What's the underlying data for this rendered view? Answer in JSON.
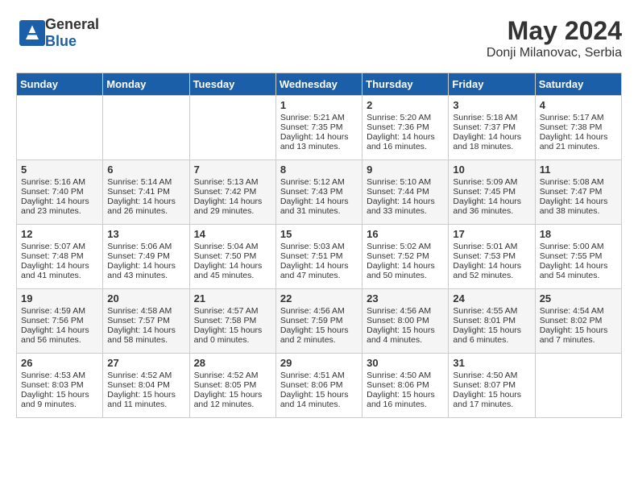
{
  "header": {
    "logo_general": "General",
    "logo_blue": "Blue",
    "month_year": "May 2024",
    "location": "Donji Milanovac, Serbia"
  },
  "days_of_week": [
    "Sunday",
    "Monday",
    "Tuesday",
    "Wednesday",
    "Thursday",
    "Friday",
    "Saturday"
  ],
  "weeks": [
    {
      "days": [
        {
          "number": "",
          "content": ""
        },
        {
          "number": "",
          "content": ""
        },
        {
          "number": "",
          "content": ""
        },
        {
          "number": "1",
          "content": "Sunrise: 5:21 AM\nSunset: 7:35 PM\nDaylight: 14 hours\nand 13 minutes."
        },
        {
          "number": "2",
          "content": "Sunrise: 5:20 AM\nSunset: 7:36 PM\nDaylight: 14 hours\nand 16 minutes."
        },
        {
          "number": "3",
          "content": "Sunrise: 5:18 AM\nSunset: 7:37 PM\nDaylight: 14 hours\nand 18 minutes."
        },
        {
          "number": "4",
          "content": "Sunrise: 5:17 AM\nSunset: 7:38 PM\nDaylight: 14 hours\nand 21 minutes."
        }
      ]
    },
    {
      "days": [
        {
          "number": "5",
          "content": "Sunrise: 5:16 AM\nSunset: 7:40 PM\nDaylight: 14 hours\nand 23 minutes."
        },
        {
          "number": "6",
          "content": "Sunrise: 5:14 AM\nSunset: 7:41 PM\nDaylight: 14 hours\nand 26 minutes."
        },
        {
          "number": "7",
          "content": "Sunrise: 5:13 AM\nSunset: 7:42 PM\nDaylight: 14 hours\nand 29 minutes."
        },
        {
          "number": "8",
          "content": "Sunrise: 5:12 AM\nSunset: 7:43 PM\nDaylight: 14 hours\nand 31 minutes."
        },
        {
          "number": "9",
          "content": "Sunrise: 5:10 AM\nSunset: 7:44 PM\nDaylight: 14 hours\nand 33 minutes."
        },
        {
          "number": "10",
          "content": "Sunrise: 5:09 AM\nSunset: 7:45 PM\nDaylight: 14 hours\nand 36 minutes."
        },
        {
          "number": "11",
          "content": "Sunrise: 5:08 AM\nSunset: 7:47 PM\nDaylight: 14 hours\nand 38 minutes."
        }
      ]
    },
    {
      "days": [
        {
          "number": "12",
          "content": "Sunrise: 5:07 AM\nSunset: 7:48 PM\nDaylight: 14 hours\nand 41 minutes."
        },
        {
          "number": "13",
          "content": "Sunrise: 5:06 AM\nSunset: 7:49 PM\nDaylight: 14 hours\nand 43 minutes."
        },
        {
          "number": "14",
          "content": "Sunrise: 5:04 AM\nSunset: 7:50 PM\nDaylight: 14 hours\nand 45 minutes."
        },
        {
          "number": "15",
          "content": "Sunrise: 5:03 AM\nSunset: 7:51 PM\nDaylight: 14 hours\nand 47 minutes."
        },
        {
          "number": "16",
          "content": "Sunrise: 5:02 AM\nSunset: 7:52 PM\nDaylight: 14 hours\nand 50 minutes."
        },
        {
          "number": "17",
          "content": "Sunrise: 5:01 AM\nSunset: 7:53 PM\nDaylight: 14 hours\nand 52 minutes."
        },
        {
          "number": "18",
          "content": "Sunrise: 5:00 AM\nSunset: 7:55 PM\nDaylight: 14 hours\nand 54 minutes."
        }
      ]
    },
    {
      "days": [
        {
          "number": "19",
          "content": "Sunrise: 4:59 AM\nSunset: 7:56 PM\nDaylight: 14 hours\nand 56 minutes."
        },
        {
          "number": "20",
          "content": "Sunrise: 4:58 AM\nSunset: 7:57 PM\nDaylight: 14 hours\nand 58 minutes."
        },
        {
          "number": "21",
          "content": "Sunrise: 4:57 AM\nSunset: 7:58 PM\nDaylight: 15 hours\nand 0 minutes."
        },
        {
          "number": "22",
          "content": "Sunrise: 4:56 AM\nSunset: 7:59 PM\nDaylight: 15 hours\nand 2 minutes."
        },
        {
          "number": "23",
          "content": "Sunrise: 4:56 AM\nSunset: 8:00 PM\nDaylight: 15 hours\nand 4 minutes."
        },
        {
          "number": "24",
          "content": "Sunrise: 4:55 AM\nSunset: 8:01 PM\nDaylight: 15 hours\nand 6 minutes."
        },
        {
          "number": "25",
          "content": "Sunrise: 4:54 AM\nSunset: 8:02 PM\nDaylight: 15 hours\nand 7 minutes."
        }
      ]
    },
    {
      "days": [
        {
          "number": "26",
          "content": "Sunrise: 4:53 AM\nSunset: 8:03 PM\nDaylight: 15 hours\nand 9 minutes."
        },
        {
          "number": "27",
          "content": "Sunrise: 4:52 AM\nSunset: 8:04 PM\nDaylight: 15 hours\nand 11 minutes."
        },
        {
          "number": "28",
          "content": "Sunrise: 4:52 AM\nSunset: 8:05 PM\nDaylight: 15 hours\nand 12 minutes."
        },
        {
          "number": "29",
          "content": "Sunrise: 4:51 AM\nSunset: 8:06 PM\nDaylight: 15 hours\nand 14 minutes."
        },
        {
          "number": "30",
          "content": "Sunrise: 4:50 AM\nSunset: 8:06 PM\nDaylight: 15 hours\nand 16 minutes."
        },
        {
          "number": "31",
          "content": "Sunrise: 4:50 AM\nSunset: 8:07 PM\nDaylight: 15 hours\nand 17 minutes."
        },
        {
          "number": "",
          "content": ""
        }
      ]
    }
  ]
}
